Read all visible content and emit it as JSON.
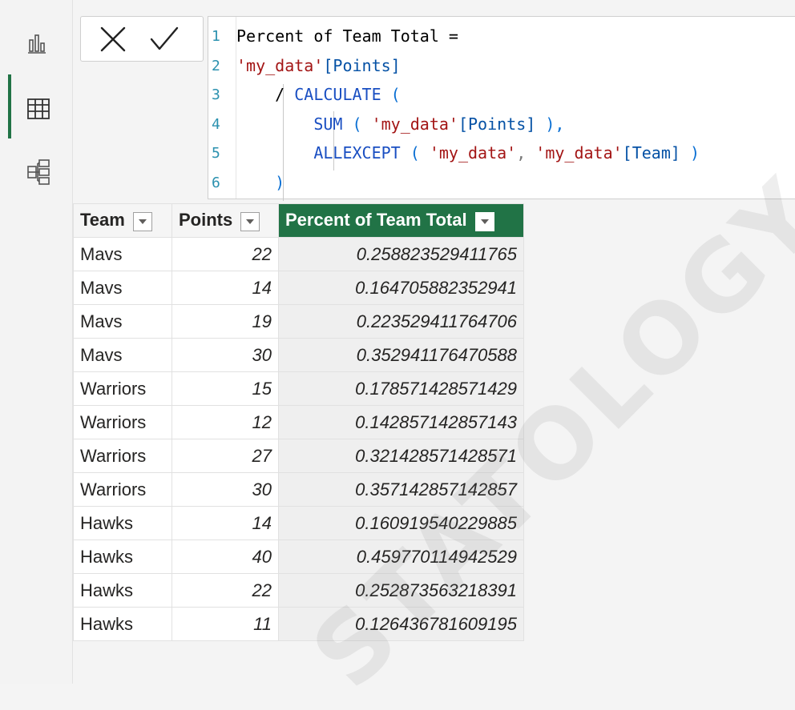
{
  "formula": {
    "lines": [
      {
        "n": "1",
        "tokens": [
          {
            "t": "Percent of Team Total =",
            "c": "t-black"
          }
        ]
      },
      {
        "n": "2",
        "tokens": [
          {
            "t": "'my_data'",
            "c": "t-str"
          },
          {
            "t": "[Points]",
            "c": "t-blue"
          }
        ]
      },
      {
        "n": "3",
        "tokens": [
          {
            "t": "    / ",
            "c": "t-op"
          },
          {
            "t": "CALCULATE",
            "c": "t-dax"
          },
          {
            "t": " (",
            "c": "t-paren"
          }
        ]
      },
      {
        "n": "4",
        "tokens": [
          {
            "t": "        SUM",
            "c": "t-dax"
          },
          {
            "t": " ( ",
            "c": "t-paren"
          },
          {
            "t": "'my_data'",
            "c": "t-str"
          },
          {
            "t": "[Points]",
            "c": "t-blue"
          },
          {
            "t": " ),",
            "c": "t-paren"
          }
        ]
      },
      {
        "n": "5",
        "tokens": [
          {
            "t": "        ALLEXCEPT",
            "c": "t-dax"
          },
          {
            "t": " ( ",
            "c": "t-paren"
          },
          {
            "t": "'my_data'",
            "c": "t-str"
          },
          {
            "t": ", ",
            "c": "t-grey"
          },
          {
            "t": "'my_data'",
            "c": "t-str"
          },
          {
            "t": "[Team]",
            "c": "t-blue"
          },
          {
            "t": " )",
            "c": "t-paren"
          }
        ]
      },
      {
        "n": "6",
        "tokens": [
          {
            "t": "    )",
            "c": "t-paren"
          }
        ]
      }
    ]
  },
  "table": {
    "headers": [
      "Team",
      "Points",
      "Percent of Team Total"
    ],
    "rows": [
      [
        "Mavs",
        "22",
        "0.258823529411765"
      ],
      [
        "Mavs",
        "14",
        "0.164705882352941"
      ],
      [
        "Mavs",
        "19",
        "0.223529411764706"
      ],
      [
        "Mavs",
        "30",
        "0.352941176470588"
      ],
      [
        "Warriors",
        "15",
        "0.178571428571429"
      ],
      [
        "Warriors",
        "12",
        "0.142857142857143"
      ],
      [
        "Warriors",
        "27",
        "0.321428571428571"
      ],
      [
        "Warriors",
        "30",
        "0.357142857142857"
      ],
      [
        "Hawks",
        "14",
        "0.160919540229885"
      ],
      [
        "Hawks",
        "40",
        "0.459770114942529"
      ],
      [
        "Hawks",
        "22",
        "0.252873563218391"
      ],
      [
        "Hawks",
        "11",
        "0.126436781609195"
      ]
    ]
  },
  "rail": {
    "items": [
      "report-view-icon",
      "table-view-icon",
      "model-view-icon"
    ],
    "active": "table-view-icon"
  },
  "watermark": "STATOLOGY.ORG",
  "colors": {
    "accent": "#217346"
  }
}
